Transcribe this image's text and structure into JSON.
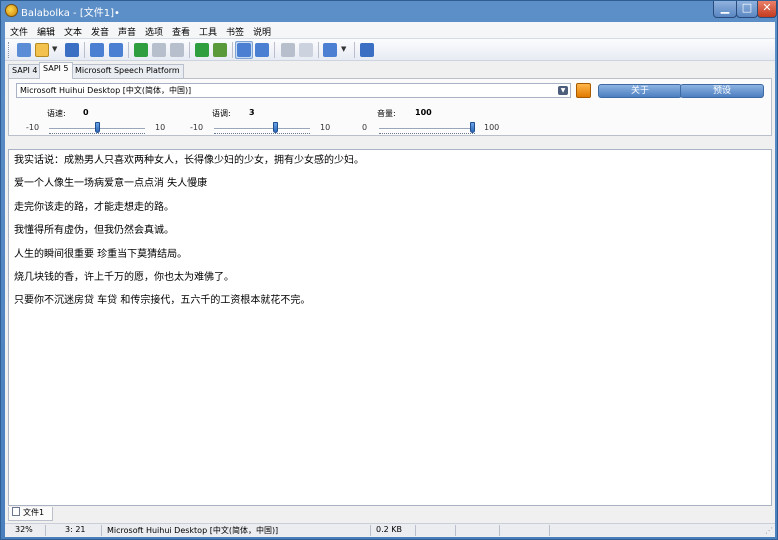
{
  "window": {
    "title": "Balabolka - [文件1]•"
  },
  "menu": [
    "文件",
    "编辑",
    "文本",
    "发音",
    "声音",
    "选项",
    "查看",
    "工具",
    "书签",
    "说明"
  ],
  "toolbar": {
    "icons": [
      "new-file-icon",
      "open-folder-icon",
      "save-icon",
      "read-aloud-icon",
      "save-audio-icon",
      "play-icon",
      "pause-icon",
      "stop-icon",
      "convert-icon",
      "export-icon",
      "clipboard-monitor-icon",
      "translate-icon",
      "dictionary-icon",
      "speaker-icon",
      "help-icon"
    ],
    "icon_colors": [
      "#5b8dd6",
      "#f2c14e",
      "#3a6fc4",
      "#4b7fd1",
      "#4b7fd1",
      "#2e9e3e",
      "#b8bfcc",
      "#b8bfcc",
      "#2e9e3e",
      "#5b9a3a",
      "#4b7fd1",
      "#4b7fd1",
      "#b8bfcc",
      "#4b7fd1",
      "#3a6fc4"
    ]
  },
  "engine_tabs": [
    "SAPI 4",
    "SAPI 5",
    "Microsoft Speech Platform"
  ],
  "engine_tab_active": "SAPI 5",
  "voice": {
    "selected": "Microsoft Huihui Desktop [中文(简体，中国)]",
    "about_button": "关于",
    "presets_button": "预设"
  },
  "sliders": [
    {
      "label": "语速:",
      "value": "0",
      "min": "-10",
      "max": "10",
      "fraction": 0.5
    },
    {
      "label": "语调:",
      "value": "3",
      "min": "-10",
      "max": "10",
      "fraction": 0.65
    },
    {
      "label": "音量:",
      "value": "100",
      "min": "0",
      "max": "100",
      "fraction": 1.0
    }
  ],
  "text_lines": [
    "我实话说：成熟男人只喜欢两种女人，长得像少妇的少女，拥有少女感的少妇。",
    "爱一个人像生一场病爱意一点点消 失人慢康",
    "走完你该走的路，才能走想走的路。",
    "我懂得所有虚伪，但我仍然会真诚。",
    "人生的瞬间很重要 珍重当下莫猜结局。",
    "烧几块钱的香，许上千万的愿，你也太为难佛了。",
    "只要你不沉迷房贷 车贷 和传宗接代，五六千的工资根本就花不完。"
  ],
  "document_tab": "文件1",
  "status": {
    "zoom": "32%",
    "position": "3:  21",
    "voice": "Microsoft Huihui Desktop [中文(简体，中国)]",
    "size": "0.2 KB"
  }
}
